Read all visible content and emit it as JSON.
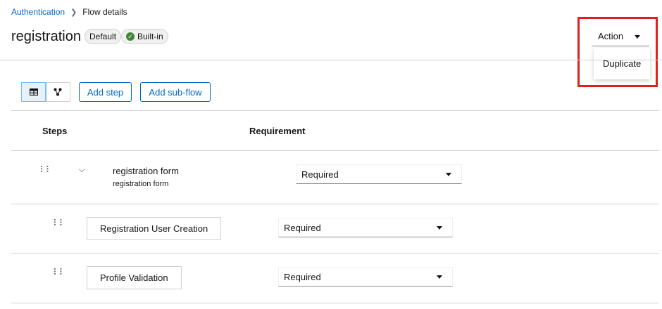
{
  "breadcrumb": {
    "link": "Authentication",
    "current": "Flow details"
  },
  "header": {
    "title": "registration",
    "badges": [
      "Default",
      "Built-in"
    ]
  },
  "action": {
    "label": "Action",
    "menu_items": [
      "Duplicate"
    ]
  },
  "toolbar": {
    "view_modes": [
      "table-icon",
      "diagram-icon"
    ],
    "add_step": "Add step",
    "add_subflow": "Add sub-flow"
  },
  "table": {
    "headers": [
      "Steps",
      "Requirement"
    ],
    "rows": [
      {
        "name": "registration form",
        "description": "registration form",
        "requirement": "Required",
        "expandable": true
      },
      {
        "name": "Registration User Creation",
        "requirement": "Required"
      },
      {
        "name": "Profile Validation",
        "requirement": "Required"
      }
    ]
  },
  "colors": {
    "link": "#0066cc",
    "highlight": "#e31c1c",
    "success": "#3e8635"
  }
}
